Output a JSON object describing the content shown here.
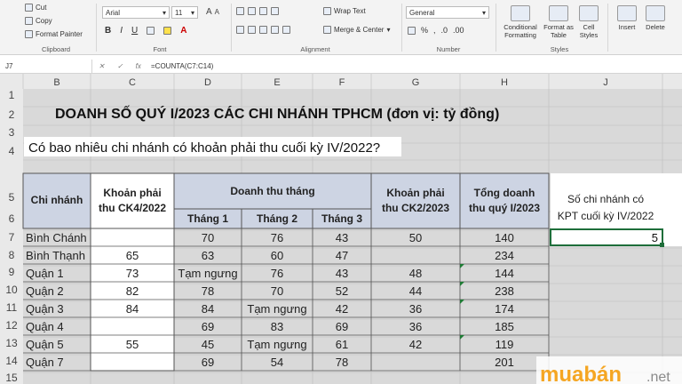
{
  "ribbon": {
    "clipboard": {
      "cut": "Cut",
      "copy": "Copy",
      "format_painter": "Format Painter",
      "label": "Clipboard"
    },
    "font": {
      "name": "Arial",
      "size": "11",
      "label": "Font",
      "bold": "B",
      "italic": "I",
      "underline": "U"
    },
    "alignment": {
      "wrap": "Wrap Text",
      "merge": "Merge & Center",
      "label": "Alignment"
    },
    "number": {
      "format": "General",
      "label": "Number"
    },
    "styles": {
      "conditional": "Conditional Formatting",
      "format_table": "Format as Table",
      "cell_styles": "Cell Styles",
      "label": "Styles"
    },
    "cells": {
      "insert": "Insert",
      "delete": "Delete"
    }
  },
  "formula_bar": {
    "cell_ref": "J7",
    "formula": "=COUNTA(C7:C14)"
  },
  "sheet": {
    "columns": [
      "B",
      "C",
      "D",
      "E",
      "F",
      "G",
      "H",
      "J"
    ],
    "rows": [
      "1",
      "2",
      "3",
      "4",
      "5",
      "6",
      "7",
      "8",
      "9",
      "10",
      "11",
      "12",
      "13",
      "14",
      "15"
    ],
    "title": "DOANH SỐ QUÝ I/2023 CÁC CHI NHÁNH TPHCM (đơn vị: tỷ đồng)",
    "question": "Có bao nhiêu chi nhánh có khoản phải thu cuối kỳ IV/2022?",
    "headers": {
      "branch": "Chi nhánh",
      "receivable_q4_line1": "Khoản phải",
      "receivable_q4_line2": "thu CK4/2022",
      "monthly_revenue": "Doanh thu tháng",
      "month1": "Tháng 1",
      "month2": "Tháng 2",
      "month3": "Tháng 3",
      "receivable_q2_line1": "Khoản phải",
      "receivable_q2_line2": "thu CK2/2023",
      "total_line1": "Tổng doanh",
      "total_line2": "thu quý I/2023"
    },
    "data_rows": [
      {
        "branch": "Bình Chánh",
        "rq4": "",
        "m1": "70",
        "m2": "76",
        "m3": "43",
        "rq2": "50",
        "total": "140"
      },
      {
        "branch": "Bình Thạnh",
        "rq4": "65",
        "m1": "63",
        "m2": "60",
        "m3": "47",
        "rq2": "",
        "total": "234"
      },
      {
        "branch": "Quận 1",
        "rq4": "73",
        "m1": "Tạm ngưng",
        "m2": "76",
        "m3": "43",
        "rq2": "48",
        "total": "144"
      },
      {
        "branch": "Quận 2",
        "rq4": "82",
        "m1": "78",
        "m2": "70",
        "m3": "52",
        "rq2": "44",
        "total": "238"
      },
      {
        "branch": "Quận 3",
        "rq4": "84",
        "m1": "84",
        "m2": "Tạm ngưng",
        "m3": "42",
        "rq2": "36",
        "total": "174"
      },
      {
        "branch": "Quận 4",
        "rq4": "",
        "m1": "69",
        "m2": "83",
        "m3": "69",
        "rq2": "36",
        "total": "185"
      },
      {
        "branch": "Quận 5",
        "rq4": "55",
        "m1": "45",
        "m2": "Tạm ngưng",
        "m3": "61",
        "rq2": "42",
        "total": "119"
      },
      {
        "branch": "Quận 7",
        "rq4": "",
        "m1": "69",
        "m2": "54",
        "m3": "78",
        "rq2": "",
        "total": "201"
      }
    ],
    "result_box": {
      "line1": "Số chi nhánh có",
      "line2": "KPT cuối kỳ IV/2022",
      "value": "5"
    }
  },
  "watermark": {
    "text": "muabán",
    "suffix": ".net"
  },
  "colors": {
    "header_fill": "#cdd4e3",
    "selection_fill": "#ffffff",
    "title_text": "#111111",
    "row_band": "#d9d9d9",
    "brand": "#f5a623"
  }
}
